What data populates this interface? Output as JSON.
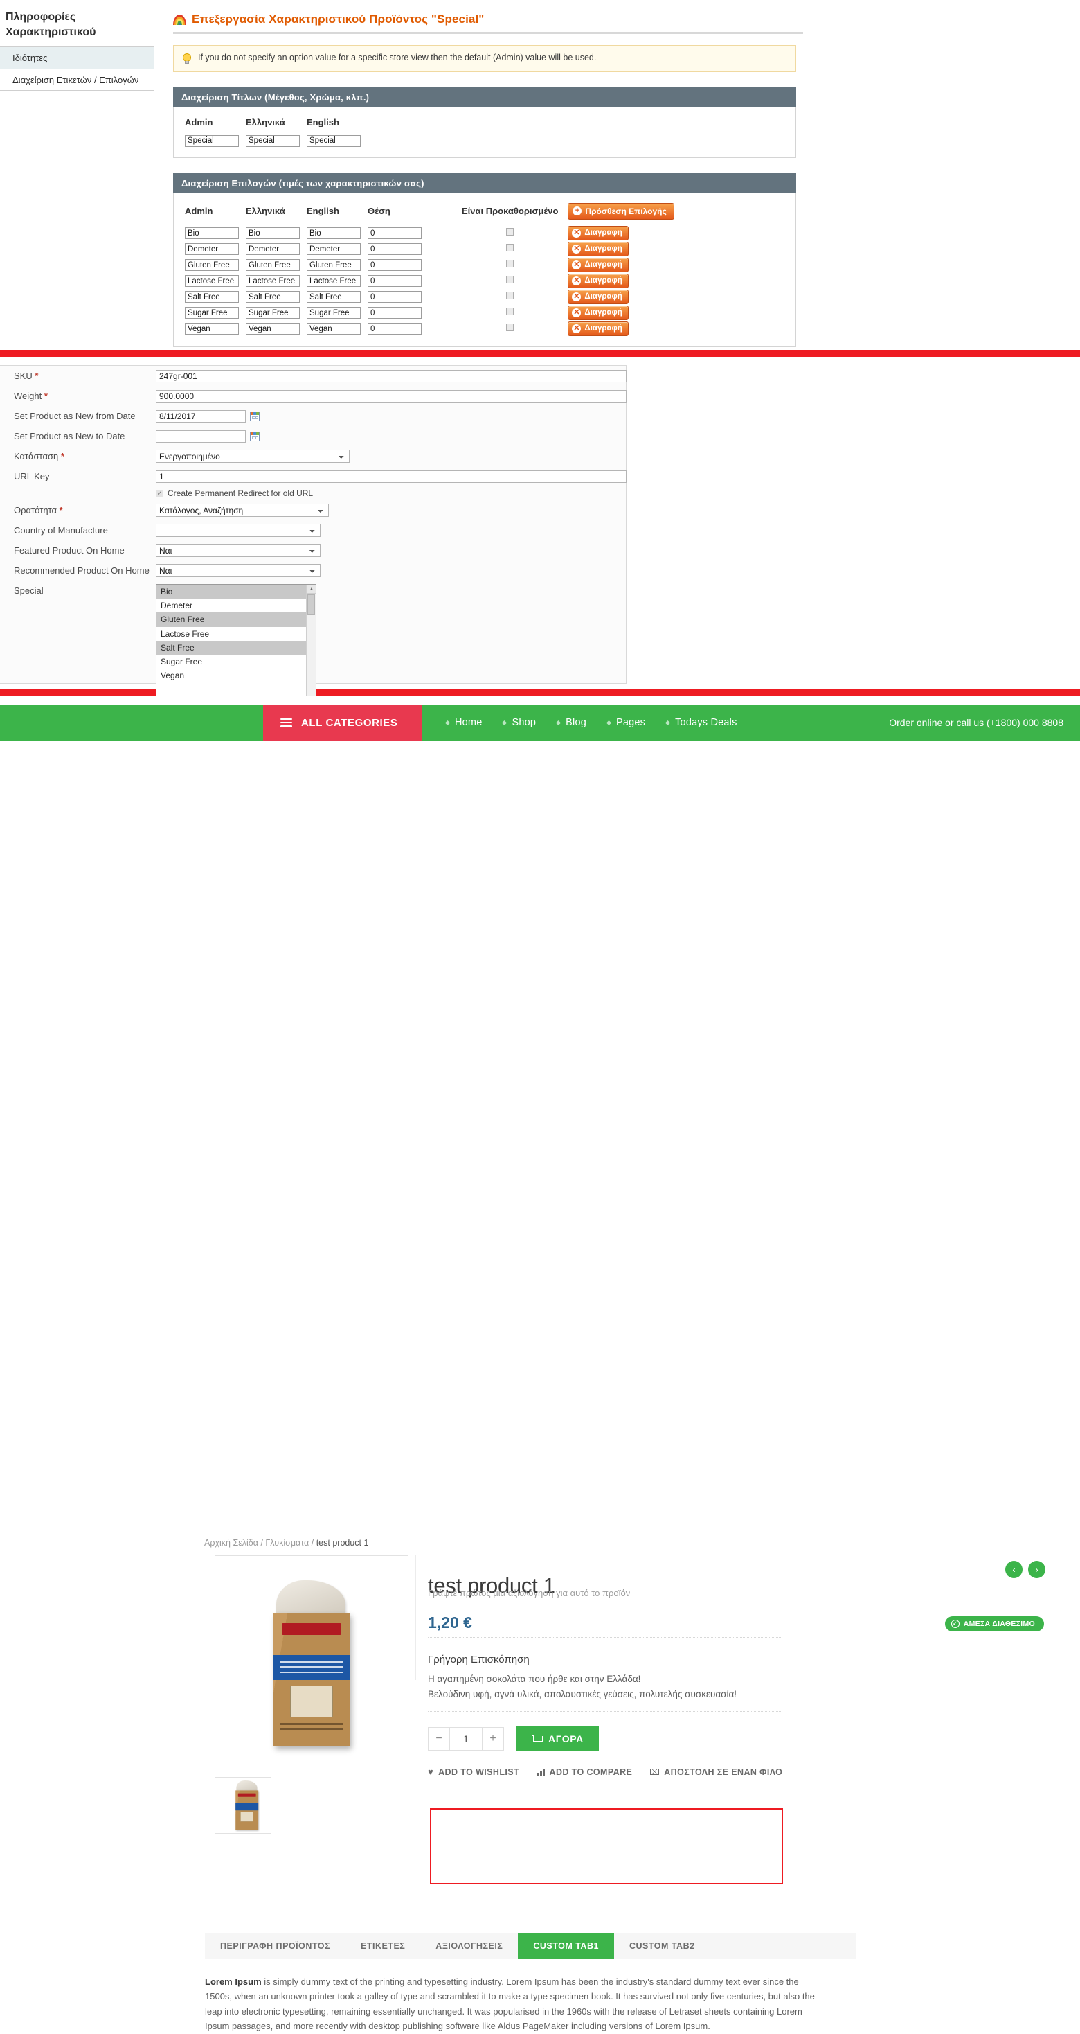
{
  "admin": {
    "sidebar": {
      "title": "Πληροφορίες Χαρακτηριστικού",
      "items": [
        {
          "label": "Ιδιότητες",
          "active": true
        },
        {
          "label": "Διαχείριση Ετικετών / Επιλογών",
          "active": false
        }
      ]
    },
    "page_title": "Επεξεργασία Χαρακτηριστικού Προϊόντος \"Special\"",
    "notice": "If you do not specify an option value for a specific store view then the default (Admin) value will be used.",
    "labels_panel": {
      "title": "Διαχείριση Τίτλων (Μέγεθος, Χρώμα, κλπ.)",
      "columns": [
        "Admin",
        "Ελληνικά",
        "English"
      ],
      "values": [
        "Special",
        "Special",
        "Special"
      ]
    },
    "options_panel": {
      "title": "Διαχείριση Επιλογών (τιμές των χαρακτηριστικών σας)",
      "columns": [
        "Admin",
        "Ελληνικά",
        "English",
        "Θέση",
        "Είναι Προκαθορισμένο"
      ],
      "add_button": "Πρόσθεση Επιλογής",
      "delete_button": "Διαγραφή",
      "rows": [
        {
          "admin": "Bio",
          "greek": "Bio",
          "english": "Bio",
          "position": "0",
          "is_default": false
        },
        {
          "admin": "Demeter",
          "greek": "Demeter",
          "english": "Demeter",
          "position": "0",
          "is_default": false
        },
        {
          "admin": "Gluten Free",
          "greek": "Gluten Free",
          "english": "Gluten Free",
          "position": "0",
          "is_default": false
        },
        {
          "admin": "Lactose Free",
          "greek": "Lactose Free",
          "english": "Lactose Free",
          "position": "0",
          "is_default": false
        },
        {
          "admin": "Salt Free",
          "greek": "Salt Free",
          "english": "Salt Free",
          "position": "0",
          "is_default": false
        },
        {
          "admin": "Sugar Free",
          "greek": "Sugar Free",
          "english": "Sugar Free",
          "position": "0",
          "is_default": false
        },
        {
          "admin": "Vegan",
          "greek": "Vegan",
          "english": "Vegan",
          "position": "0",
          "is_default": false
        }
      ]
    }
  },
  "product_form": {
    "fields": [
      {
        "label": "SKU",
        "required": true,
        "value": "247gr-001"
      },
      {
        "label": "Weight",
        "required": true,
        "value": "900.0000"
      },
      {
        "label": "Set Product as New from Date",
        "required": false,
        "value": "8/11/2017"
      },
      {
        "label": "Set Product as New to Date",
        "required": false,
        "value": ""
      },
      {
        "label": "Κατάσταση",
        "required": true,
        "value": "Ενεργοποιημένο"
      },
      {
        "label": "URL Key",
        "required": false,
        "value": "1"
      },
      {
        "label": "Ορατότητα",
        "required": true,
        "value": "Κατάλογος, Αναζήτηση"
      },
      {
        "label": "Country of Manufacture",
        "required": false,
        "value": ""
      },
      {
        "label": "Featured Product On Home",
        "required": false,
        "value": "Ναι"
      },
      {
        "label": "Recommended Product On Home",
        "required": false,
        "value": "Ναι"
      },
      {
        "label": "Special",
        "required": false,
        "value": ""
      }
    ],
    "redirect_checkbox_label": "Create Permanent Redirect for old URL",
    "redirect_checked": true,
    "special_options": [
      {
        "label": "Bio",
        "selected": true
      },
      {
        "label": "Demeter",
        "selected": false
      },
      {
        "label": "Gluten Free",
        "selected": true
      },
      {
        "label": "Lactose Free",
        "selected": false
      },
      {
        "label": "Salt Free",
        "selected": true
      },
      {
        "label": "Sugar Free",
        "selected": false
      },
      {
        "label": "Vegan",
        "selected": false
      }
    ]
  },
  "storefront": {
    "nav": {
      "all_categories": "ALL CATEGORIES",
      "links": [
        "Home",
        "Shop",
        "Blog",
        "Pages",
        "Todays Deals"
      ],
      "phone": "Order online or call us (+1800) 000 8808"
    },
    "breadcrumb": [
      "Αρχική Σελίδα",
      "Γλυκίσματα",
      "test product 1"
    ],
    "product": {
      "title": "test product 1",
      "review_link": "Γράψτε πρώτος μια αξιολόγηση για αυτό το προϊόν",
      "price": "1,20 €",
      "stock_badge": "ΑΜΕΣΑ ΔΙΑΘΕΣΙΜΟ",
      "overview_title": "Γρήγορη Επισκόπηση",
      "overview_line1": "Η αγαπημένη σοκολάτα που ήρθε και στην Ελλάδα!",
      "overview_line2": "Βελούδινη υφή, αγνά υλικά, απολαυστικές γεύσεις, πολυτελής συσκευασία!",
      "qty": "1",
      "qty_minus": "−",
      "qty_plus": "+",
      "buy_button": "ΑΓΟΡΑ",
      "actions": [
        "ADD TO WISHLIST",
        "ADD TO COMPARE",
        "ΑΠΟΣΤΟΛΗ ΣΕ ΕΝΑΝ ΦΙΛΟ"
      ],
      "prev_arrow": "‹",
      "next_arrow": "›"
    },
    "tabs": [
      {
        "label": "ΠΕΡΙΓΡΑΦΗ ΠΡΟΪΟΝΤΟΣ",
        "active": false
      },
      {
        "label": "ΕΤΙΚΕΤΕΣ",
        "active": false
      },
      {
        "label": "ΑΞΙΟΛΟΓΗΣΕΙΣ",
        "active": false
      },
      {
        "label": "CUSTOM TAB1",
        "active": true
      },
      {
        "label": "CUSTOM TAB2",
        "active": false
      }
    ],
    "description_lead": "Lorem Ipsum",
    "description": " is simply dummy text of the printing and typesetting industry. Lorem Ipsum has been the industry's standard dummy text ever since the 1500s, when an unknown printer took a galley of type and scrambled it to make a type specimen book. It has survived not only five centuries, but also the leap into electronic typesetting, remaining essentially unchanged. It was popularised in the 1960s with the release of Letraset sheets containing Lorem Ipsum passages, and more recently with desktop publishing software like Aldus PageMaker including versions of Lorem Ipsum."
  },
  "colors": {
    "admin_title": "#e05a00",
    "panel_head": "#63737e",
    "brand_green": "#3cb44a",
    "brand_red": "#e8394f",
    "price_blue": "#2f6690",
    "divider_red": "#ee1b22"
  }
}
